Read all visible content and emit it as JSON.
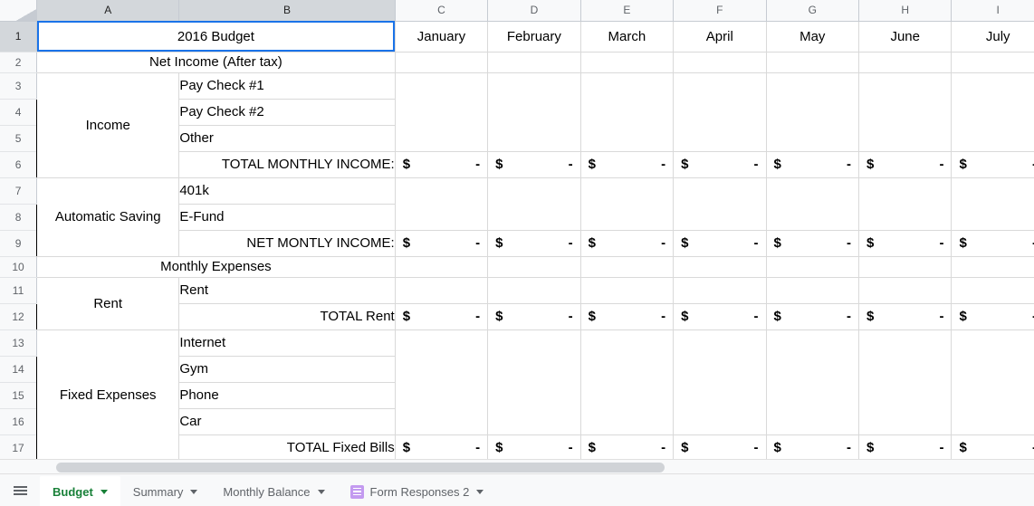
{
  "spreadsheet": {
    "title": "2016 Budget",
    "selected_cell": "A1",
    "column_headers": [
      "A",
      "B",
      "C",
      "D",
      "E",
      "F",
      "G",
      "H",
      "I"
    ],
    "row_headers": [
      "1",
      "2",
      "3",
      "4",
      "5",
      "6",
      "7",
      "8",
      "9",
      "10",
      "11",
      "12",
      "13",
      "14",
      "15",
      "16",
      "17"
    ],
    "months": [
      {
        "label": "January",
        "color": "#ccfffd"
      },
      {
        "label": "February",
        "color": "#ccfffd"
      },
      {
        "label": "March",
        "color": "#ccfffd"
      },
      {
        "label": "April",
        "color": "#ffa0c5"
      },
      {
        "label": "May",
        "color": "#ffa0c5"
      },
      {
        "label": "June",
        "color": "#ffa0c5"
      },
      {
        "label": "July",
        "color": "#cb9bf8"
      }
    ],
    "sections": {
      "net_income_header": "Net Income (After tax)",
      "monthly_expenses_header": "Monthly Expenses"
    },
    "groups": {
      "income": "Income",
      "automatic_saving": "Automatic Saving",
      "rent": "Rent",
      "fixed_expenses": "Fixed Expenses"
    },
    "line_items": {
      "pay_check_1": "Pay Check #1",
      "pay_check_2": "Pay Check #2",
      "other": "Other",
      "k401": "401k",
      "efund": "E-Fund",
      "rent": "Rent",
      "internet": "Internet",
      "gym": "Gym",
      "phone": "Phone",
      "car": "Car"
    },
    "totals": {
      "total_monthly_income": "TOTAL MONTHLY INCOME:",
      "net_monthly_income": "NET MONTLY INCOME:",
      "total_rent": "TOTAL Rent",
      "total_fixed_bills": "TOTAL Fixed Bills"
    },
    "money": {
      "currency": "$",
      "zero": "-"
    },
    "colors": {
      "label_fill": "#dce9f8",
      "value_fill": "#fdf2cd",
      "total_fill": "#a6a6a6",
      "subtotal_fill": "#d0cece",
      "red_text": "#ff0000",
      "selection": "#1a73e8"
    }
  },
  "tabs": {
    "all_sheets_label": "All Sheets",
    "items": [
      {
        "label": "Budget",
        "active": true,
        "icon": ""
      },
      {
        "label": "Summary",
        "active": false,
        "icon": ""
      },
      {
        "label": "Monthly Balance",
        "active": false,
        "icon": ""
      },
      {
        "label": "Form Responses 2",
        "active": false,
        "icon": "form-icon"
      }
    ]
  }
}
